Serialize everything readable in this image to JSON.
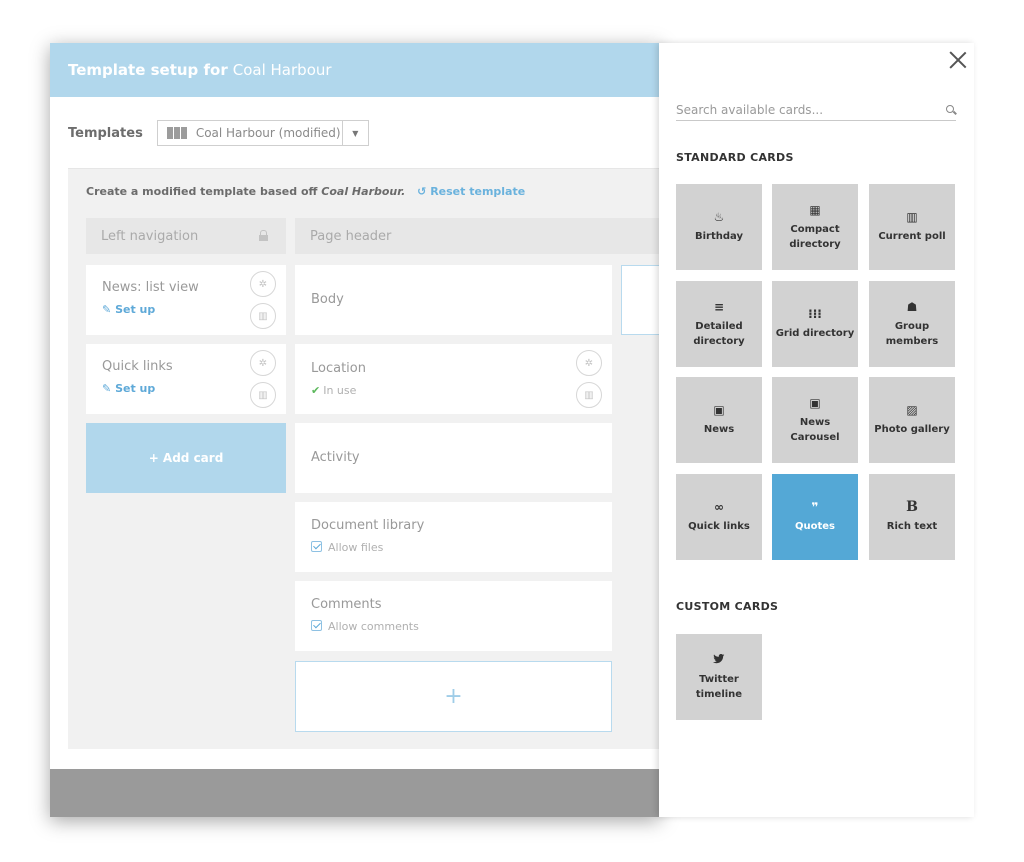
{
  "modal": {
    "title_prefix": "Template setup for",
    "title_name": "Coal Harbour",
    "templates_label": "Templates",
    "template_value": "Coal Harbour (modified)",
    "note_text": "Create a modified template based off",
    "note_template": "Coal Harbour.",
    "reset_label": "Reset template",
    "left_column": {
      "header": "Left navigation",
      "cards": [
        {
          "title": "News: list view",
          "action": "Set up"
        },
        {
          "title": "Quick links",
          "action": "Set up"
        }
      ],
      "add_label": "+ Add card"
    },
    "body_column": {
      "header": "Page header",
      "cards": [
        {
          "title": "Body"
        },
        {
          "title": "Location",
          "status": "In use"
        },
        {
          "title": "Activity"
        },
        {
          "title": "Document library",
          "option": "Allow files"
        },
        {
          "title": "Comments",
          "option": "Allow comments"
        }
      ],
      "add_symbol": "+"
    }
  },
  "panel": {
    "search_placeholder": "Search available cards...",
    "standard_heading": "STANDARD CARDS",
    "custom_heading": "CUSTOM CARDS",
    "standard_cards": [
      {
        "label": "Birthday",
        "icon": "birthday-cake-icon",
        "glyph": "♨"
      },
      {
        "label": "Compact directory",
        "icon": "grid-large-icon",
        "glyph": "▦"
      },
      {
        "label": "Current poll",
        "icon": "bar-chart-icon",
        "glyph": "▥"
      },
      {
        "label": "Detailed directory",
        "icon": "list-icon",
        "glyph": "≡"
      },
      {
        "label": "Grid directory",
        "icon": "grid-icon",
        "glyph": "⁝⁝⁝"
      },
      {
        "label": "Group members",
        "icon": "users-icon",
        "glyph": "☗"
      },
      {
        "label": "News",
        "icon": "newspaper-icon",
        "glyph": "▣"
      },
      {
        "label": "News Carousel",
        "icon": "newspaper-icon",
        "glyph": "▣"
      },
      {
        "label": "Photo gallery",
        "icon": "image-icon",
        "glyph": "▨"
      },
      {
        "label": "Quick links",
        "icon": "link-icon",
        "glyph": "∞"
      },
      {
        "label": "Quotes",
        "icon": "quote-icon",
        "glyph": "❞"
      },
      {
        "label": "Rich text",
        "icon": "bold-icon",
        "glyph": "B"
      }
    ],
    "selected_card": "Quotes",
    "custom_cards": [
      {
        "label": "Twitter timeline",
        "icon": "twitter-icon",
        "glyph": "🐦"
      }
    ]
  },
  "colors": {
    "header": "#b1d7ec",
    "selected_tile": "#54a8d6",
    "tile": "#d2d2d2",
    "link": "#5ea9d8"
  }
}
